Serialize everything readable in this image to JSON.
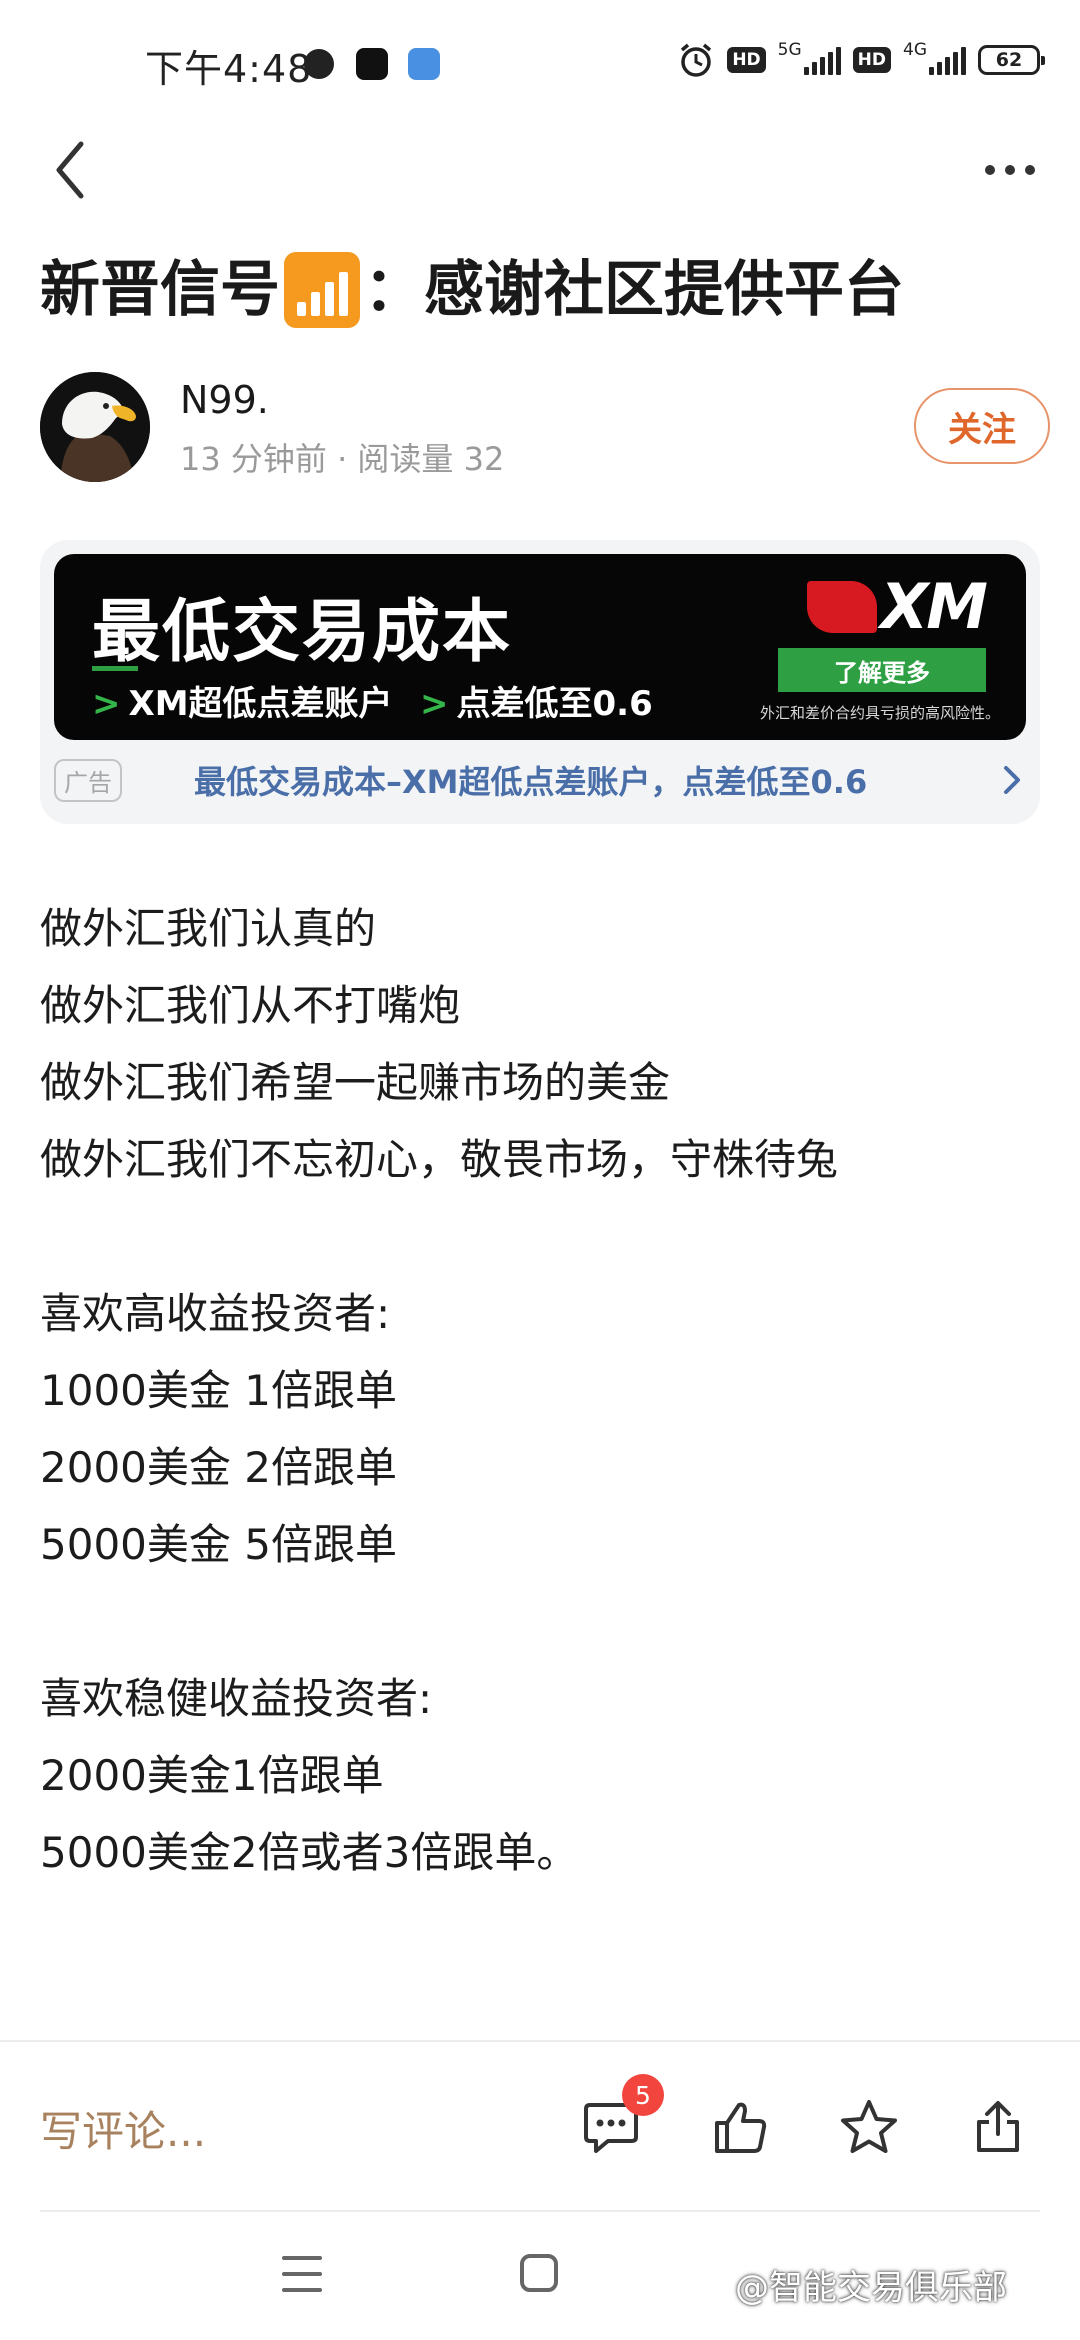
{
  "status_bar": {
    "time": "下午4:48",
    "network_1": "5G",
    "network_2": "4G",
    "hd_1": "HD",
    "hd_2": "HD",
    "battery": "62"
  },
  "article": {
    "title_part1": "新晋信号",
    "title_part2": "：感谢社区提供平台",
    "author_name": "N99.",
    "meta": "13 分钟前 · 阅读量 32",
    "follow_label": "关注"
  },
  "ad": {
    "headline": "最低交易成本",
    "point_1": "XM超低点差账户",
    "point_2": "点差低至0.6",
    "logo": "XM",
    "cta": "了解更多",
    "disclaimer": "外汇和差价合约具亏损的高风险性。",
    "badge": "广告",
    "link_text": "最低交易成本–XM超低点差账户，点差低至0.6"
  },
  "body": {
    "lines": [
      "做外汇我们认真的",
      "做外汇我们从不打嘴炮",
      "做外汇我们希望一起赚市场的美金",
      "做外汇我们不忘初心，敬畏市场，守株待兔",
      "",
      "喜欢高收益投资者:",
      "1000美金 1倍跟单",
      "2000美金 2倍跟单",
      "5000美金 5倍跟单",
      "",
      "喜欢稳健收益投资者:",
      "2000美金1倍跟单",
      "5000美金2倍或者3倍跟单。"
    ]
  },
  "action_bar": {
    "comment_placeholder": "写评论...",
    "comment_count": "5"
  },
  "watermark": "@智能交易俱乐部",
  "colors": {
    "accent": "#e0672b",
    "ad_link": "#4a6ea8",
    "ad_green": "#2ea043",
    "xm_red": "#d71921",
    "badge_red": "#f2453d",
    "comment_text": "#a8825e"
  },
  "icons": [
    "back-icon",
    "more-icon",
    "signal-bars-icon",
    "comment-icon",
    "like-icon",
    "star-icon",
    "share-icon",
    "chevron-right-icon",
    "menu-icon",
    "home-icon"
  ]
}
